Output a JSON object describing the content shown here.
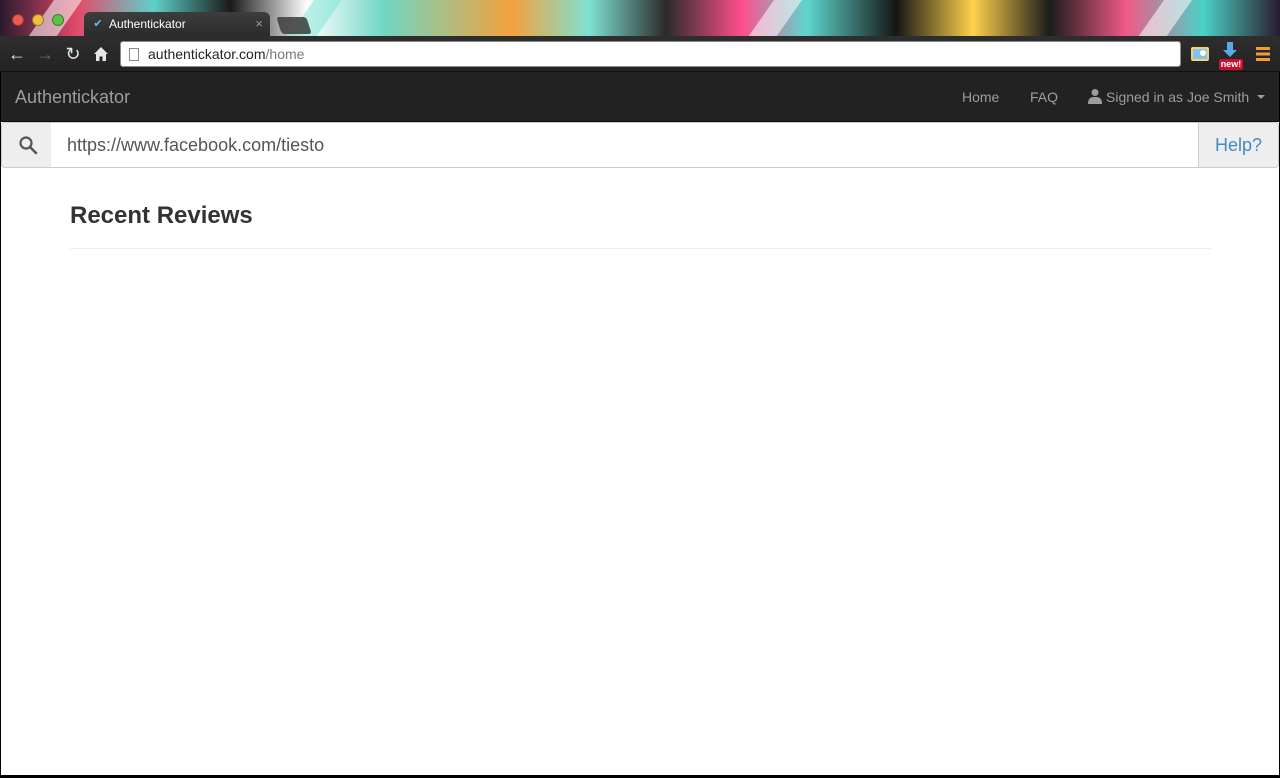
{
  "browser": {
    "tab": {
      "title": "Authentickator"
    },
    "address_bar": {
      "host": "authentickator.com",
      "path": "/home"
    },
    "extension_badge": "new!"
  },
  "navbar": {
    "brand": "Authentickator",
    "links": [
      {
        "label": "Home"
      },
      {
        "label": "FAQ"
      }
    ],
    "user_menu": {
      "label": "Signed in as Joe Smith"
    }
  },
  "search": {
    "value": "https://www.facebook.com/tiesto",
    "help_label": "Help?"
  },
  "main": {
    "heading": "Recent Reviews"
  },
  "colors": {
    "navbar_bg": "#222222",
    "navbar_text": "#9d9d9d",
    "link_blue": "#428bca",
    "heading_text": "#333333"
  }
}
